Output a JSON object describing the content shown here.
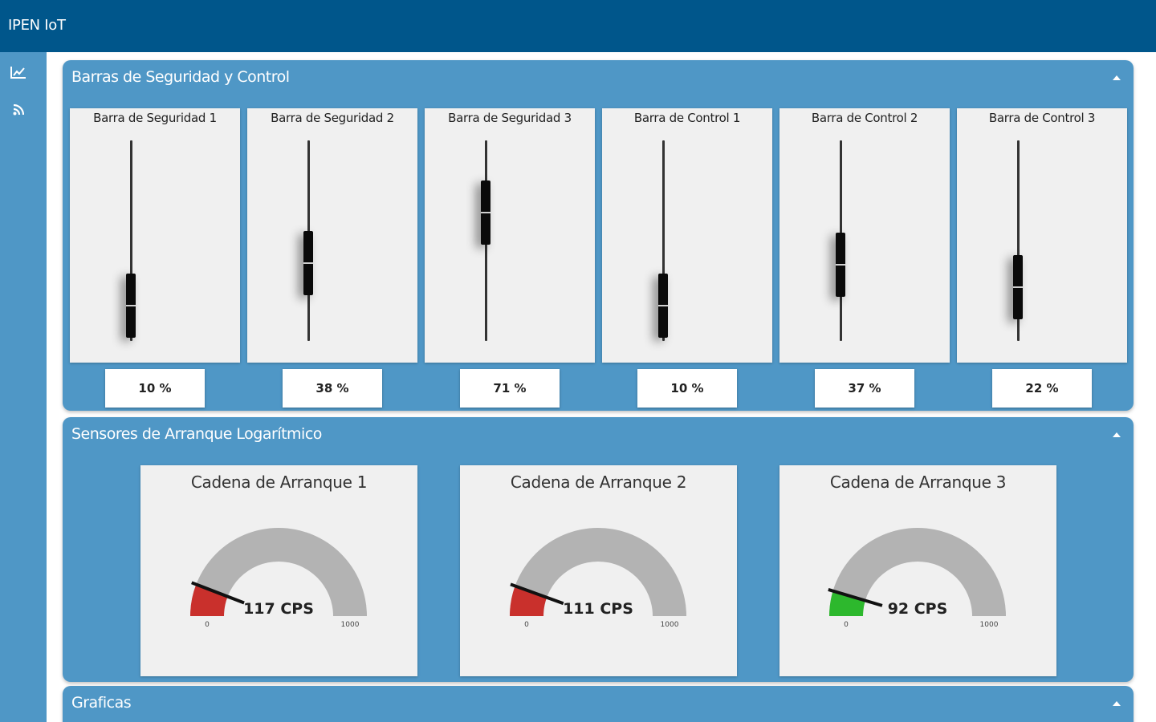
{
  "app": {
    "title": "IPEN IoT"
  },
  "sidebar": {
    "items": [
      {
        "icon": "line-chart-icon"
      },
      {
        "icon": "rss-feed-icon"
      }
    ]
  },
  "groups": {
    "barras": {
      "title": "Barras de Seguridad y Control",
      "bars": [
        {
          "label": "Barra de Seguridad 1",
          "value": 10,
          "display": "10 %"
        },
        {
          "label": "Barra de Seguridad 2",
          "value": 38,
          "display": "38 %"
        },
        {
          "label": "Barra de Seguridad 3",
          "value": 71,
          "display": "71 %"
        },
        {
          "label": "Barra de Control 1",
          "value": 10,
          "display": "10 %"
        },
        {
          "label": "Barra de Control 2",
          "value": 37,
          "display": "37 %"
        },
        {
          "label": "Barra de Control 3",
          "value": 22,
          "display": "22 %"
        }
      ]
    },
    "sensores": {
      "title": "Sensores de Arranque Logarítmico",
      "gauges": [
        {
          "label": "Cadena de Arranque 1",
          "value": 117,
          "display": "117 CPS",
          "min": "0",
          "max": "1000",
          "color": "#c9302c"
        },
        {
          "label": "Cadena de Arranque 2",
          "value": 111,
          "display": "111 CPS",
          "min": "0",
          "max": "1000",
          "color": "#c9302c"
        },
        {
          "label": "Cadena de Arranque 3",
          "value": 92,
          "display": "92 CPS",
          "min": "0",
          "max": "1000",
          "color": "#2db82d"
        }
      ]
    },
    "graficas": {
      "title": "Graficas"
    }
  },
  "colors": {
    "header": "#00568b",
    "panel": "#4f97c6",
    "card": "#f0f0f0",
    "gauge_track": "#b3b3b3"
  }
}
